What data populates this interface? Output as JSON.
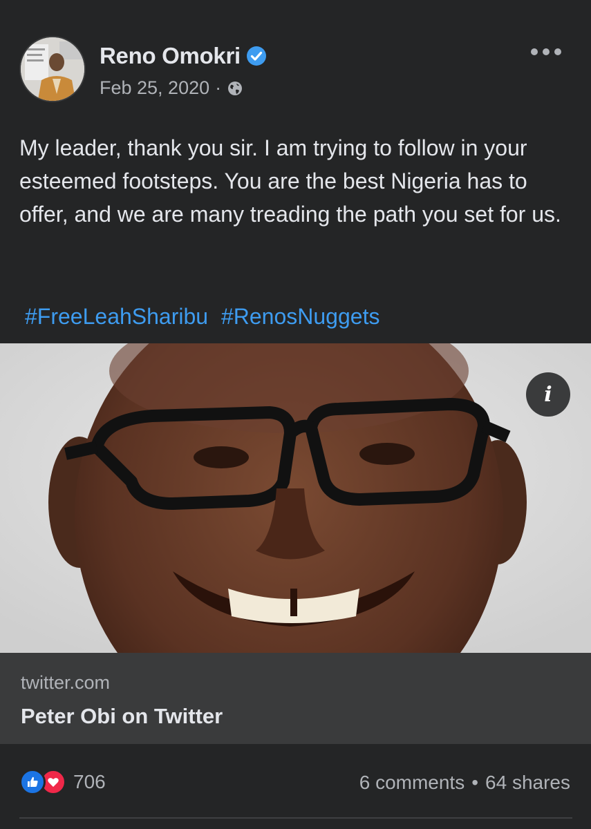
{
  "post": {
    "author": "Reno Omokri",
    "date": "Feb 25, 2020",
    "separator": "·",
    "privacy_icon": "globe-icon",
    "verified_icon": "verified-badge-icon",
    "menu_icon": "more-options-icon",
    "text": "My leader, thank you sir. I am trying to follow in your esteemed footsteps. You are the best Nigeria has to offer, and we are many treading the path you set for us.",
    "hashtags": [
      "#FreeLeahSharibu",
      "#RenosNuggets"
    ]
  },
  "media": {
    "info_button_label": "i"
  },
  "link_preview": {
    "domain": "twitter.com",
    "title": "Peter Obi on Twitter"
  },
  "engagement": {
    "reaction_icons": [
      "like-icon",
      "love-icon"
    ],
    "reaction_count": "706",
    "comments": "6 comments",
    "separator": "•",
    "shares": "64 shares"
  },
  "colors": {
    "background": "#242526",
    "text_primary": "#e4e6eb",
    "text_secondary": "#b0b3b8",
    "hashtag": "#3e9cf0",
    "link_preview_bg": "#3a3b3c",
    "like": "#1b74e4",
    "love": "#f02849"
  }
}
